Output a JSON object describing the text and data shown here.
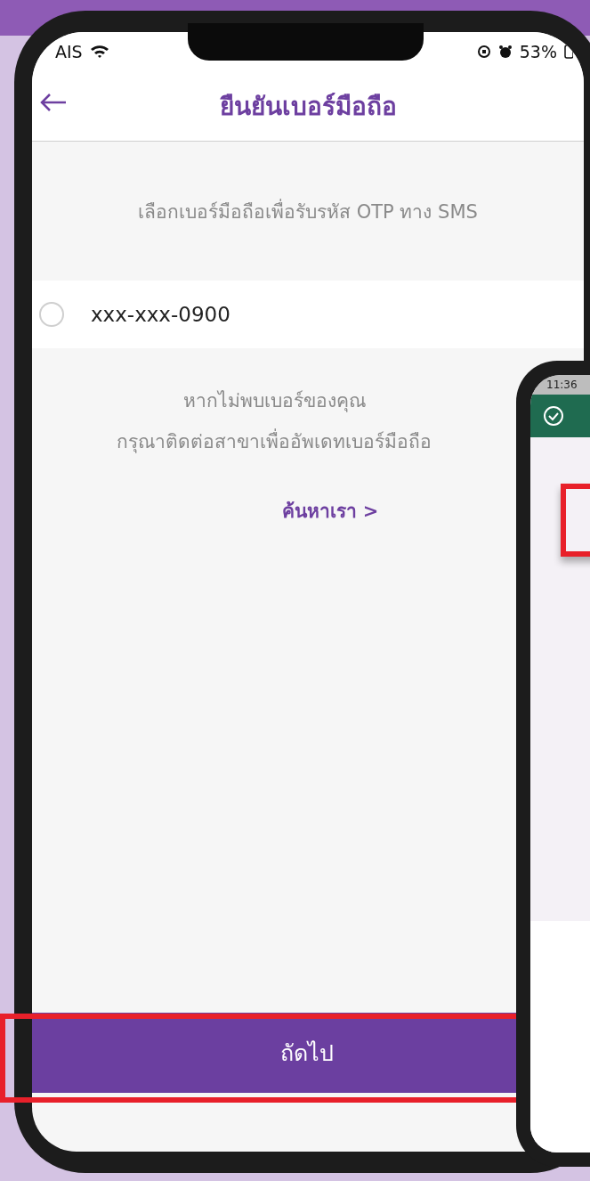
{
  "status_bar": {
    "carrier": "AIS",
    "battery": "53%"
  },
  "header": {
    "title": "ยืนยันเบอร์มือถือ"
  },
  "instruction": "เลือกเบอร์มือถือเพื่อรับรหัส OTP ทาง SMS",
  "phone_options": [
    {
      "number": "xxx-xxx-0900",
      "selected": false
    }
  ],
  "help_text": [
    "หากไม่พบเบอร์ของคุณ",
    "กรุณาติดต่อสาขาเพื่ออัพเดทเบอร์มือถือ"
  ],
  "find_us_link": "ค้นหาเรา >",
  "next_button": "ถัดไป",
  "second_phone": {
    "time": "11:36"
  }
}
